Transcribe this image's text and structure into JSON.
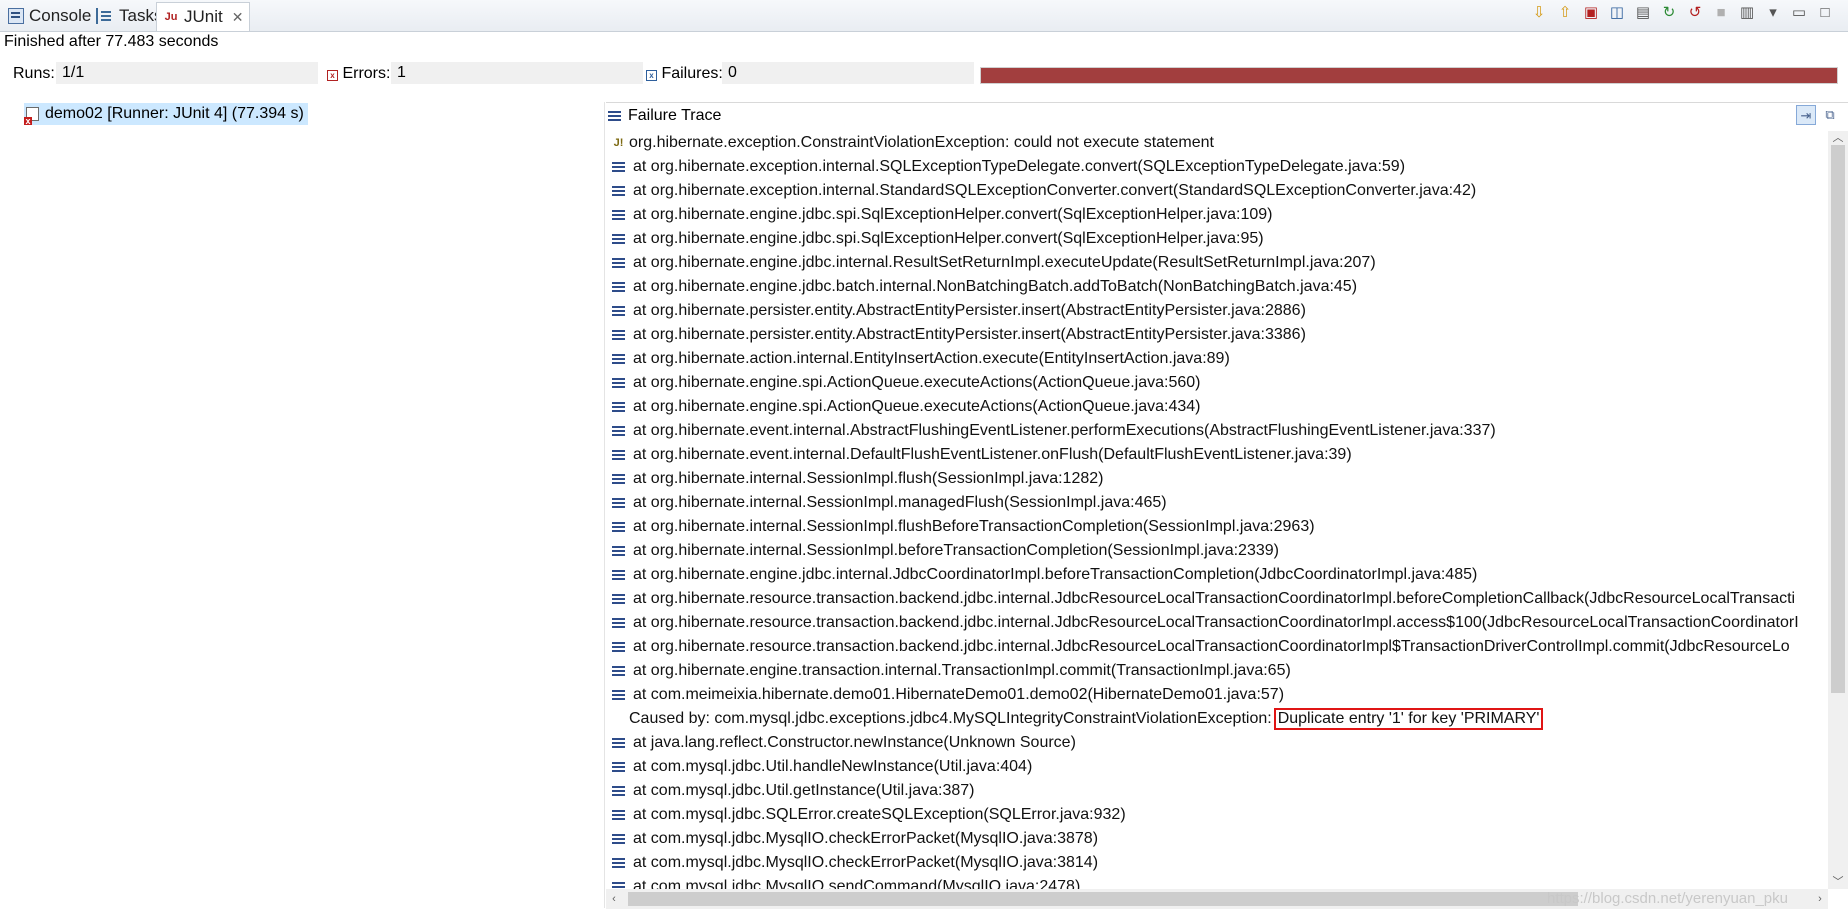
{
  "tabs": [
    {
      "label": "Console",
      "icon": "console-icon"
    },
    {
      "label": "Tasks",
      "icon": "tasks-icon"
    },
    {
      "label": "JUnit",
      "icon": "junit-icon",
      "active": true
    }
  ],
  "toolbar_icons": [
    "next-failure-icon",
    "previous-failure-icon",
    "show-failures-only-icon",
    "scroll-lock-icon",
    "history-icon",
    "rerun-test-icon",
    "rerun-failed-first-icon",
    "stop-icon",
    "layout-icon",
    "view-menu-icon",
    "minimize-icon",
    "maximize-icon"
  ],
  "status": {
    "finished": "Finished after 77.483 seconds",
    "runs_label": "Runs:",
    "runs_value": "1/1",
    "errors_label": "Errors:",
    "errors_value": "1",
    "failures_label": "Failures:",
    "failures_value": "0",
    "progress": 1.0,
    "progress_color": "#a23e3e"
  },
  "tree": {
    "item_label": "demo02 [Runner: JUnit 4] (77.394 s)"
  },
  "trace": {
    "title": "Failure Trace",
    "lines": [
      {
        "kind": "exception",
        "text": "org.hibernate.exception.ConstraintViolationException: could not execute statement"
      },
      {
        "kind": "frame",
        "text": "at org.hibernate.exception.internal.SQLExceptionTypeDelegate.convert(SQLExceptionTypeDelegate.java:59)"
      },
      {
        "kind": "frame",
        "text": "at org.hibernate.exception.internal.StandardSQLExceptionConverter.convert(StandardSQLExceptionConverter.java:42)"
      },
      {
        "kind": "frame",
        "text": "at org.hibernate.engine.jdbc.spi.SqlExceptionHelper.convert(SqlExceptionHelper.java:109)"
      },
      {
        "kind": "frame",
        "text": "at org.hibernate.engine.jdbc.spi.SqlExceptionHelper.convert(SqlExceptionHelper.java:95)"
      },
      {
        "kind": "frame",
        "text": "at org.hibernate.engine.jdbc.internal.ResultSetReturnImpl.executeUpdate(ResultSetReturnImpl.java:207)"
      },
      {
        "kind": "frame",
        "text": "at org.hibernate.engine.jdbc.batch.internal.NonBatchingBatch.addToBatch(NonBatchingBatch.java:45)"
      },
      {
        "kind": "frame",
        "text": "at org.hibernate.persister.entity.AbstractEntityPersister.insert(AbstractEntityPersister.java:2886)"
      },
      {
        "kind": "frame",
        "text": "at org.hibernate.persister.entity.AbstractEntityPersister.insert(AbstractEntityPersister.java:3386)"
      },
      {
        "kind": "frame",
        "text": "at org.hibernate.action.internal.EntityInsertAction.execute(EntityInsertAction.java:89)"
      },
      {
        "kind": "frame",
        "text": "at org.hibernate.engine.spi.ActionQueue.executeActions(ActionQueue.java:560)"
      },
      {
        "kind": "frame",
        "text": "at org.hibernate.engine.spi.ActionQueue.executeActions(ActionQueue.java:434)"
      },
      {
        "kind": "frame",
        "text": "at org.hibernate.event.internal.AbstractFlushingEventListener.performExecutions(AbstractFlushingEventListener.java:337)"
      },
      {
        "kind": "frame",
        "text": "at org.hibernate.event.internal.DefaultFlushEventListener.onFlush(DefaultFlushEventListener.java:39)"
      },
      {
        "kind": "frame",
        "text": "at org.hibernate.internal.SessionImpl.flush(SessionImpl.java:1282)"
      },
      {
        "kind": "frame",
        "text": "at org.hibernate.internal.SessionImpl.managedFlush(SessionImpl.java:465)"
      },
      {
        "kind": "frame",
        "text": "at org.hibernate.internal.SessionImpl.flushBeforeTransactionCompletion(SessionImpl.java:2963)"
      },
      {
        "kind": "frame",
        "text": "at org.hibernate.internal.SessionImpl.beforeTransactionCompletion(SessionImpl.java:2339)"
      },
      {
        "kind": "frame",
        "text": "at org.hibernate.engine.jdbc.internal.JdbcCoordinatorImpl.beforeTransactionCompletion(JdbcCoordinatorImpl.java:485)"
      },
      {
        "kind": "frame",
        "text": "at org.hibernate.resource.transaction.backend.jdbc.internal.JdbcResourceLocalTransactionCoordinatorImpl.beforeCompletionCallback(JdbcResourceLocalTransacti"
      },
      {
        "kind": "frame",
        "text": "at org.hibernate.resource.transaction.backend.jdbc.internal.JdbcResourceLocalTransactionCoordinatorImpl.access$100(JdbcResourceLocalTransactionCoordinatorI"
      },
      {
        "kind": "frame",
        "text": "at org.hibernate.resource.transaction.backend.jdbc.internal.JdbcResourceLocalTransactionCoordinatorImpl$TransactionDriverControlImpl.commit(JdbcResourceLo"
      },
      {
        "kind": "frame",
        "text": "at org.hibernate.engine.transaction.internal.TransactionImpl.commit(TransactionImpl.java:65)"
      },
      {
        "kind": "frame",
        "text": "at com.meimeixia.hibernate.demo01.HibernateDemo01.demo02(HibernateDemo01.java:57)"
      },
      {
        "kind": "cause",
        "text": "Caused by: com.mysql.jdbc.exceptions.jdbc4.MySQLIntegrityConstraintViolationException:",
        "highlight": "Duplicate entry '1' for key 'PRIMARY'"
      },
      {
        "kind": "frame",
        "text": "at java.lang.reflect.Constructor.newInstance(Unknown Source)"
      },
      {
        "kind": "frame",
        "text": "at com.mysql.jdbc.Util.handleNewInstance(Util.java:404)"
      },
      {
        "kind": "frame",
        "text": "at com.mysql.jdbc.Util.getInstance(Util.java:387)"
      },
      {
        "kind": "frame",
        "text": "at com.mysql.jdbc.SQLError.createSQLException(SQLError.java:932)"
      },
      {
        "kind": "frame",
        "text": "at com.mysql.jdbc.MysqlIO.checkErrorPacket(MysqlIO.java:3878)"
      },
      {
        "kind": "frame",
        "text": "at com.mysql.jdbc.MysqlIO.checkErrorPacket(MysqlIO.java:3814)"
      },
      {
        "kind": "frame",
        "text": "at com.mysql.jdbc.MysqlIO.sendCommand(MysqlIO.java:2478)"
      }
    ]
  },
  "watermark": "https://blog.csdn.net/yerenyuan_pku",
  "colors": {
    "highlight_border": "#e01515",
    "selection": "#cce8ff",
    "error": "#b12222"
  }
}
